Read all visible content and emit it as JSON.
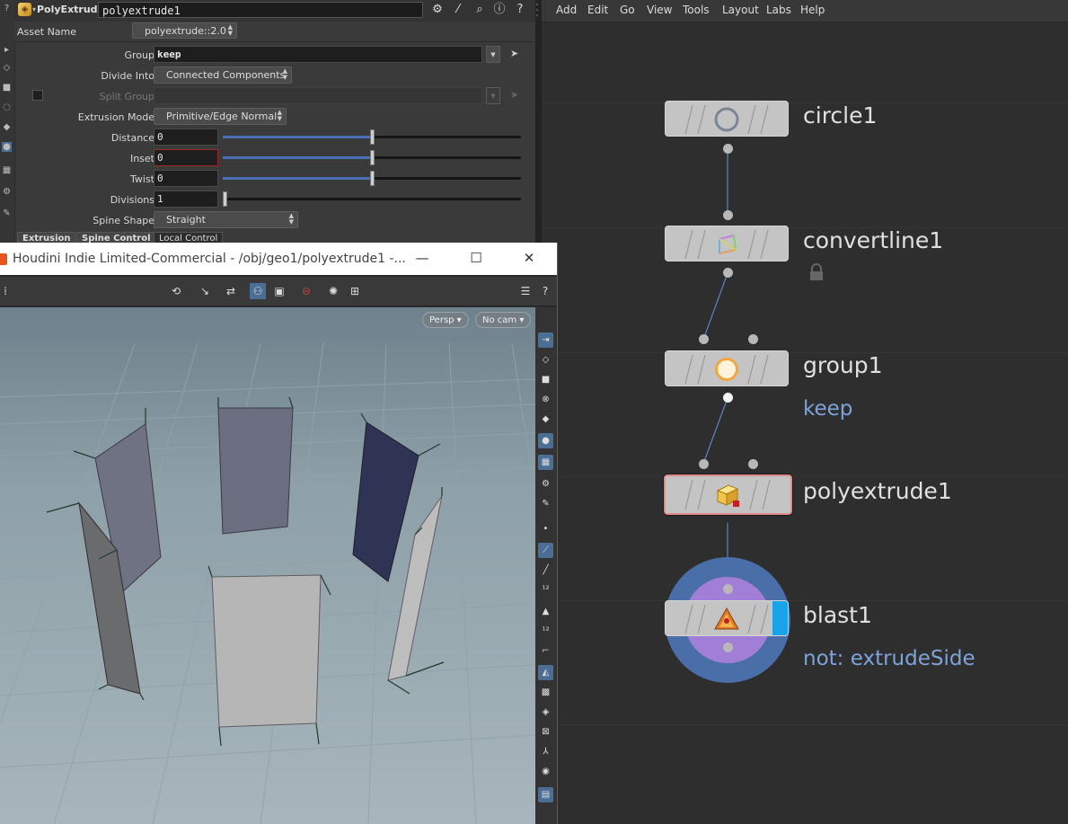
{
  "param_panel": {
    "node_type": "PolyExtrude",
    "node_name": "polyextrude1",
    "asset_name_label": "Asset Name",
    "asset_version": "polyextrude::2.0",
    "params": {
      "group": {
        "label": "Group",
        "value": "keep"
      },
      "divide_into": {
        "label": "Divide Into",
        "value": "Connected Components"
      },
      "split_group": {
        "label": "Split Group",
        "value": ""
      },
      "extrusion_mode": {
        "label": "Extrusion Mode",
        "value": "Primitive/Edge Normal"
      },
      "distance": {
        "label": "Distance",
        "value": "0",
        "slider_fraction": 0.5
      },
      "inset": {
        "label": "Inset",
        "value": "0",
        "slider_fraction": 0.5
      },
      "twist": {
        "label": "Twist",
        "value": "0",
        "slider_fraction": 0.5
      },
      "divisions": {
        "label": "Divisions",
        "value": "1",
        "slider_fraction": 0.0
      },
      "spine_shape": {
        "label": "Spine Shape",
        "value": "Straight"
      }
    },
    "tabs": [
      "Extrusion",
      "Spine Control",
      "Local Control"
    ],
    "active_tab": "Extrusion"
  },
  "network": {
    "menu": [
      "Add",
      "Edit",
      "Go",
      "View",
      "Tools",
      "Layout",
      "Labs",
      "Help"
    ],
    "nodes": [
      {
        "name": "circle1",
        "icon": "circle-icon"
      },
      {
        "name": "convertline1",
        "icon": "convertline-icon",
        "locked": true
      },
      {
        "name": "group1",
        "icon": "group-icon",
        "sublabel": "keep"
      },
      {
        "name": "polyextrude1",
        "icon": "polyextrude-icon",
        "selected": true
      },
      {
        "name": "blast1",
        "icon": "blast-icon",
        "sublabel": "not: extrudeSide",
        "display_flag": true
      }
    ],
    "colors": {
      "wire": "#5a86c4",
      "sublabel": "#7ea3d8",
      "display_flag": "#1aa3e8",
      "blast_ring_outer": "#4a6fa8",
      "blast_ring_inner": "#a27fd6"
    }
  },
  "viewport": {
    "window_title": "Houdini Indie Limited-Commercial - /obj/geo1/polyextrude1 -...",
    "persp_label": "Persp",
    "cam_label": "No cam"
  }
}
